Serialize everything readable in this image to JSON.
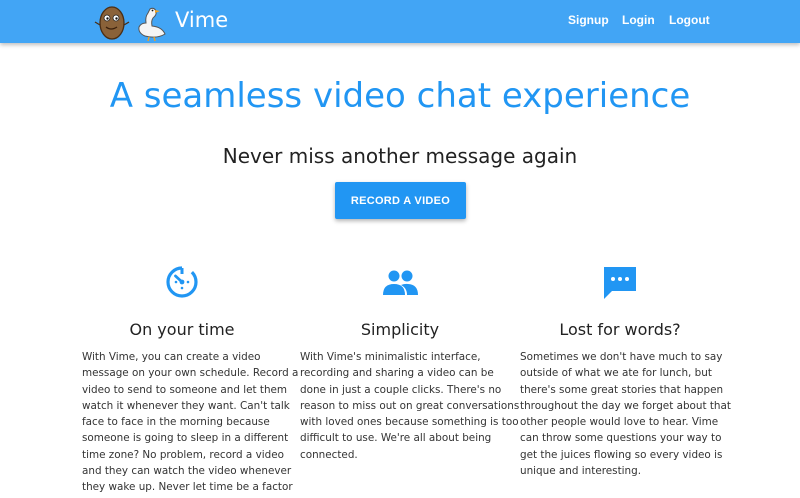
{
  "nav": {
    "brand": "Vime",
    "links": [
      "Signup",
      "Login",
      "Logout"
    ]
  },
  "hero": {
    "title": "A seamless video chat experience",
    "subtitle": "Never miss another message again",
    "cta_label": "RECORD A VIDEO"
  },
  "features": [
    {
      "icon": "timer-icon",
      "title": "On your time",
      "body": "With Vime, you can create a video message on your own schedule. Record a video to send to someone and let them watch it whenever they want. Can't talk face to face in the morning because someone is going to sleep in a different time zone? No problem, record a video and they can watch the video whenever they wake up. Never let time be a factor again."
    },
    {
      "icon": "people-icon",
      "title": "Simplicity",
      "body": "With Vime's minimalistic interface, recording and sharing a video can be done in just a couple clicks. There's no reason to miss out on great conversations with loved ones because something is too difficult to use. We're all about being connected."
    },
    {
      "icon": "chat-bubble-icon",
      "title": "Lost for words?",
      "body": "Sometimes we don't have much to say outside of what we ate for lunch, but there's some great stories that happen throughout the day we forget about that other people would love to hear. Vime can throw some questions your way to get the juices flowing so every video is unique and interesting."
    }
  ],
  "colors": {
    "navbar": "#42a5f5",
    "accent": "#2196f3"
  }
}
